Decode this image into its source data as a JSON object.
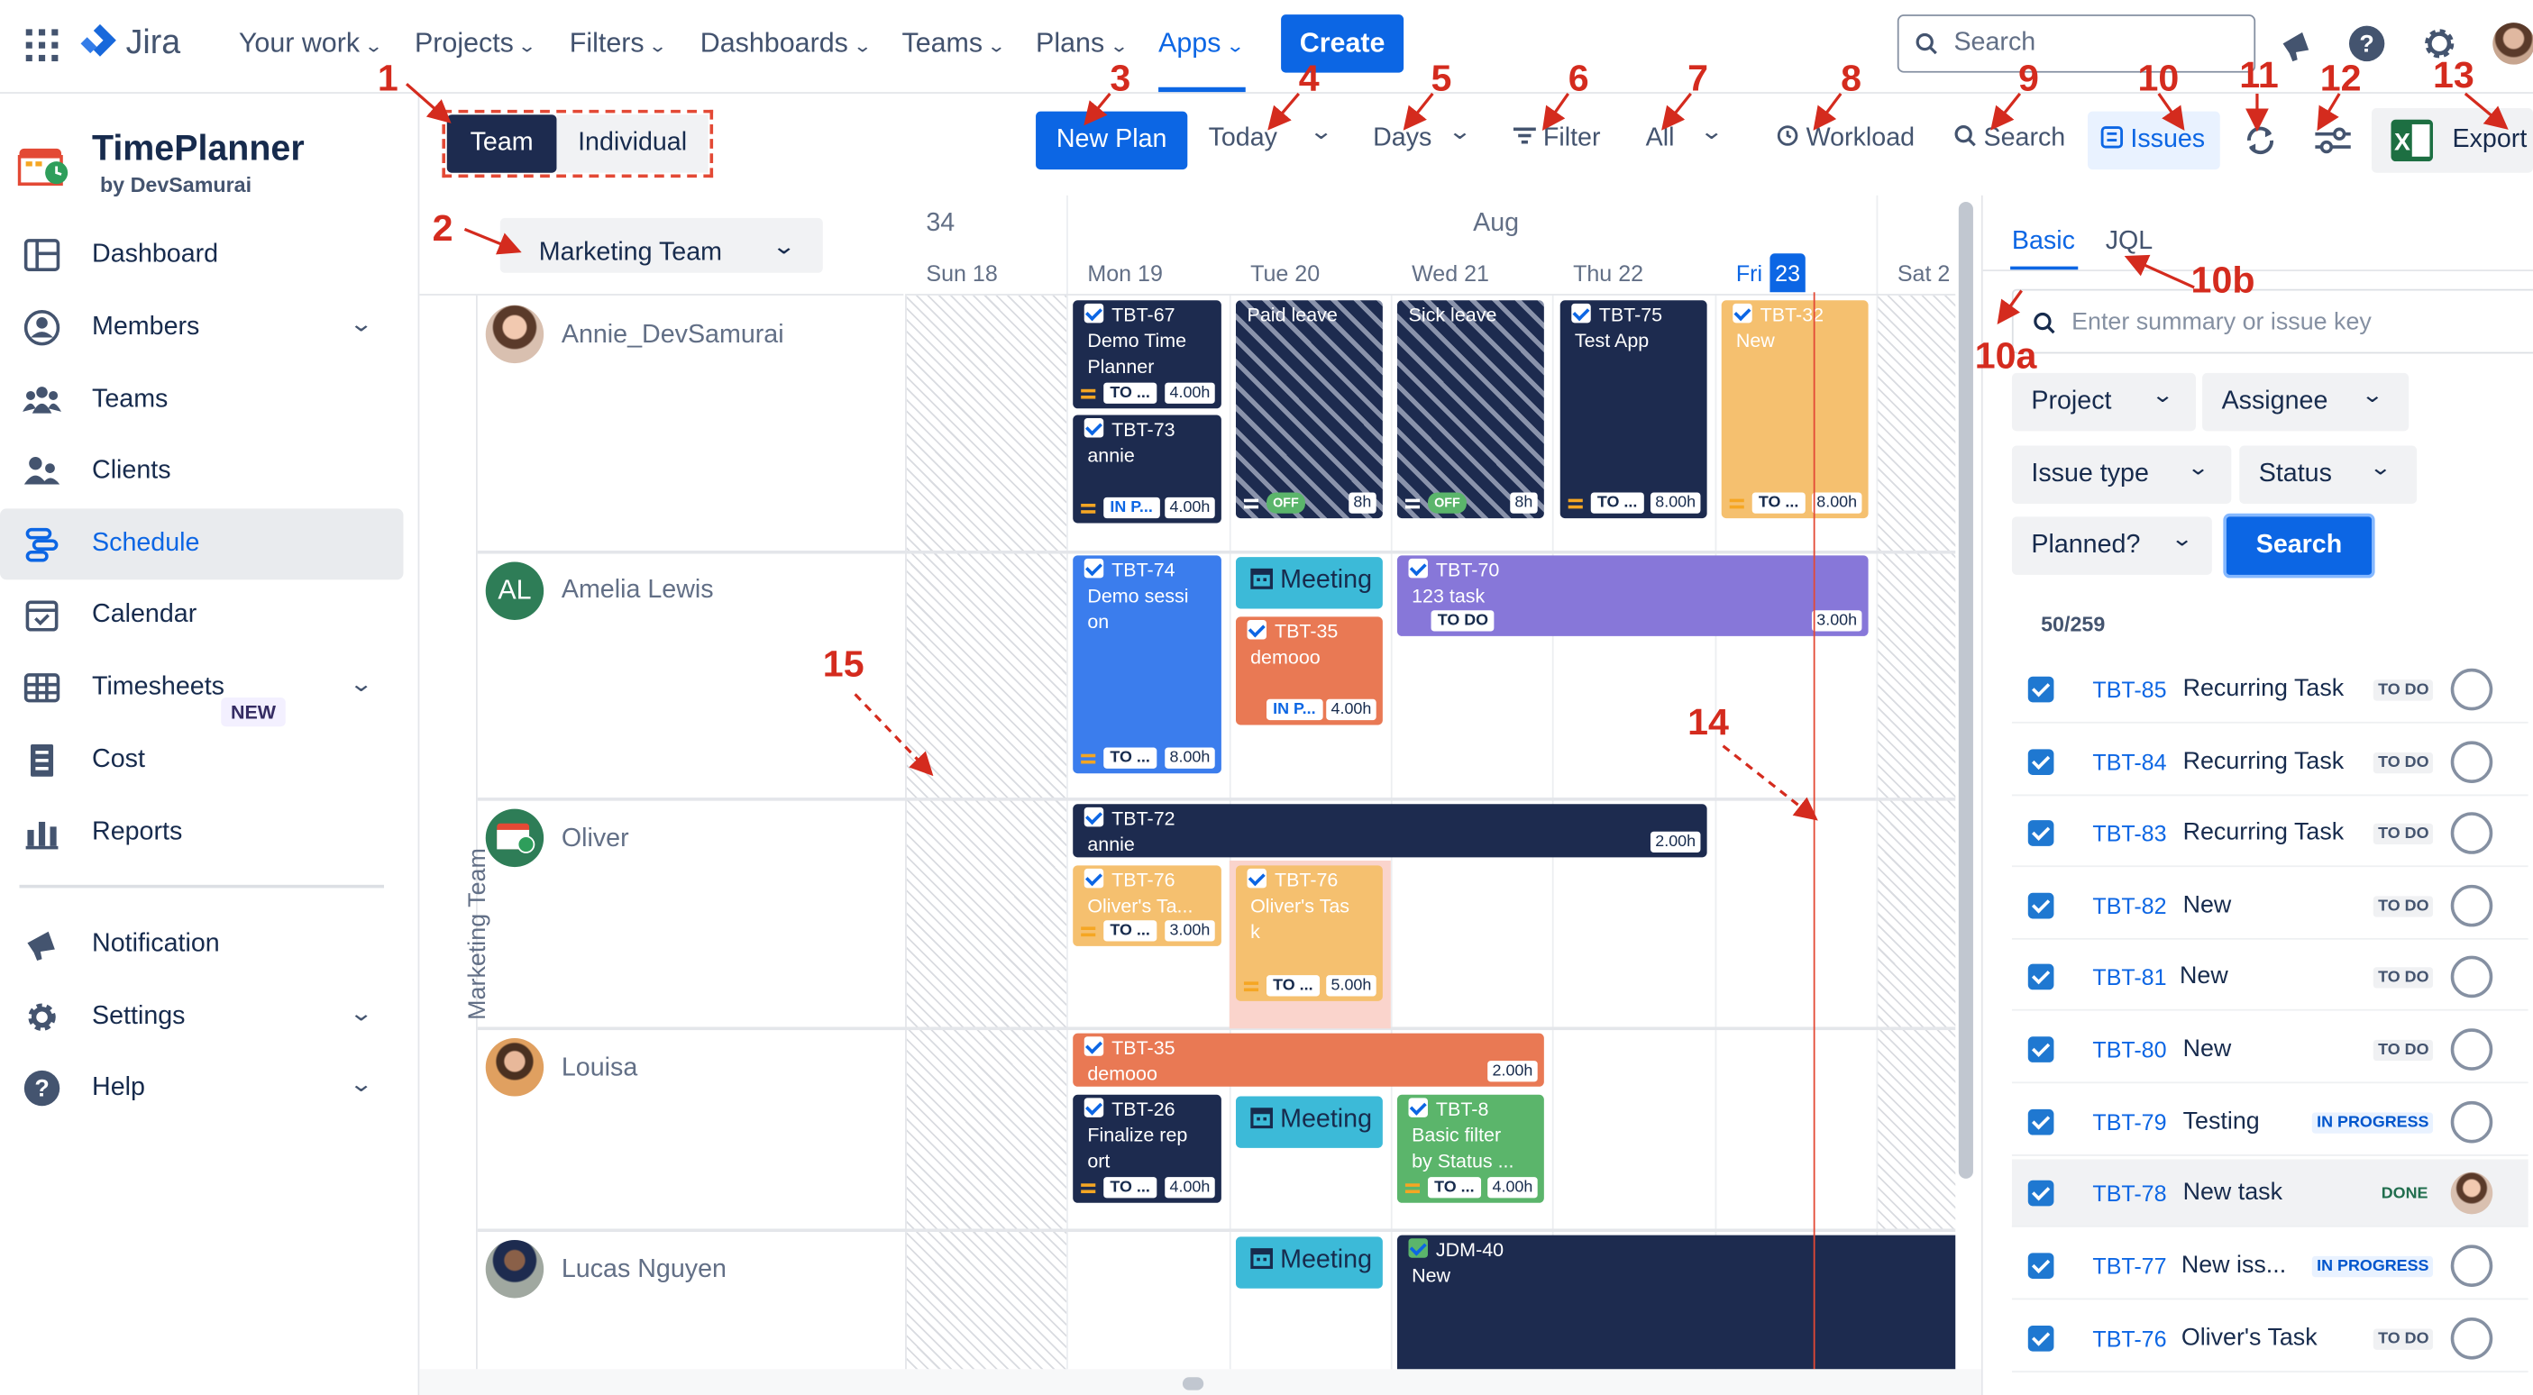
{
  "topnav": {
    "product": "Jira",
    "items": [
      {
        "label": "Your work"
      },
      {
        "label": "Projects"
      },
      {
        "label": "Filters"
      },
      {
        "label": "Dashboards"
      },
      {
        "label": "Teams"
      },
      {
        "label": "Plans"
      },
      {
        "label": "Apps"
      }
    ],
    "create_label": "Create",
    "search_placeholder": "Search"
  },
  "sidebar": {
    "app_title": "TimePlanner",
    "app_subtitle": "by DevSamurai",
    "items": [
      {
        "label": "Dashboard",
        "icon": "dashboard-icon"
      },
      {
        "label": "Members",
        "icon": "members-icon"
      },
      {
        "label": "Teams",
        "icon": "teams-icon"
      },
      {
        "label": "Clients",
        "icon": "clients-icon"
      },
      {
        "label": "Schedule",
        "icon": "schedule-icon"
      },
      {
        "label": "Calendar",
        "icon": "calendar-icon"
      },
      {
        "label": "Timesheets",
        "icon": "timesheets-icon"
      },
      {
        "label": "Cost",
        "icon": "cost-icon"
      },
      {
        "label": "Reports",
        "icon": "reports-icon"
      },
      {
        "label": "Notification",
        "icon": "megaphone-icon"
      },
      {
        "label": "Settings",
        "icon": "gear-icon"
      },
      {
        "label": "Help",
        "icon": "help-icon"
      }
    ],
    "new_badge": "NEW"
  },
  "toolbar": {
    "team_tab": "Team",
    "individual_tab": "Individual",
    "new_plan": "New Plan",
    "today": "Today",
    "days": "Days",
    "filter": "Filter",
    "all": "All",
    "workload": "Workload",
    "search": "Search",
    "issues": "Issues",
    "export": "Export"
  },
  "team_select": "Marketing Team",
  "team_vertical_label": "Marketing Team",
  "calendar": {
    "week": "34",
    "month": "Aug",
    "days": [
      {
        "label": "Sun 18"
      },
      {
        "label": "Mon 19"
      },
      {
        "label": "Tue 20"
      },
      {
        "label": "Wed 21"
      },
      {
        "label": "Thu 22"
      },
      {
        "label": "Fri",
        "num": "23"
      },
      {
        "label": "Sat 2"
      }
    ]
  },
  "people": [
    {
      "name": "Annie_DevSamurai"
    },
    {
      "name": "Amelia Lewis",
      "initials": "AL"
    },
    {
      "name": "Oliver"
    },
    {
      "name": "Louisa"
    },
    {
      "name": "Lucas Nguyen"
    }
  ],
  "cards": {
    "c1": {
      "key": "TBT-67",
      "title": "Demo Time\nPlanner",
      "status": "TO ...",
      "hours": "4.00h"
    },
    "c2": {
      "key": "TBT-73",
      "title": "annie",
      "status": "IN P...",
      "hours": "4.00h"
    },
    "c3": {
      "title": "Paid leave",
      "status": "OFF",
      "hours": "8h"
    },
    "c4": {
      "title": "Sick leave",
      "status": "OFF",
      "hours": "8h"
    },
    "c5": {
      "key": "TBT-75",
      "title": "Test App",
      "status": "TO ...",
      "hours": "8.00h"
    },
    "c6": {
      "key": "TBT-32",
      "title": "New",
      "status": "TO ...",
      "hours": "8.00h"
    },
    "c7": {
      "key": "TBT-74",
      "title": "Demo sessi\non",
      "status": "TO ...",
      "hours": "8.00h"
    },
    "c8": {
      "title": "Meeting"
    },
    "c9": {
      "key": "TBT-35",
      "title": "demooo",
      "status": "IN P...",
      "hours": "4.00h"
    },
    "c10": {
      "key": "TBT-70",
      "title": "123 task",
      "status": "TO DO",
      "hours": "3.00h"
    },
    "c11": {
      "key": "TBT-72",
      "title": "annie",
      "hours": "2.00h"
    },
    "c12": {
      "key": "TBT-76",
      "title": "Oliver's Ta...",
      "status": "TO ...",
      "hours": "3.00h"
    },
    "c13": {
      "key": "TBT-76",
      "title": "Oliver's Tas\nk",
      "status": "TO ...",
      "hours": "5.00h"
    },
    "c14": {
      "key": "TBT-35",
      "title": "demooo",
      "hours": "2.00h"
    },
    "c15": {
      "key": "TBT-26",
      "title": "Finalize rep\nort",
      "status": "TO ...",
      "hours": "4.00h"
    },
    "c16": {
      "title": "Meeting"
    },
    "c17": {
      "key": "TBT-8",
      "title": "Basic filter\nby Status ...",
      "status": "TO ...",
      "hours": "4.00h"
    },
    "c18": {
      "title": "Meeting"
    },
    "c19": {
      "key": "JDM-40",
      "title": "New"
    }
  },
  "right_panel": {
    "tab_basic": "Basic",
    "tab_jql": "JQL",
    "search_placeholder": "Enter summary or issue key",
    "filters": {
      "project": "Project",
      "assignee": "Assignee",
      "issue_type": "Issue type",
      "status": "Status",
      "planned": "Planned?"
    },
    "search_button": "Search",
    "count": "50/259",
    "issues": [
      {
        "key": "TBT-85",
        "title": "Recurring Task",
        "status": "TO DO"
      },
      {
        "key": "TBT-84",
        "title": "Recurring Task",
        "status": "TO DO"
      },
      {
        "key": "TBT-83",
        "title": "Recurring Task",
        "status": "TO DO"
      },
      {
        "key": "TBT-82",
        "title": "New",
        "status": "TO DO"
      },
      {
        "key": "TBT-81",
        "title": "New",
        "status": "TO DO"
      },
      {
        "key": "TBT-80",
        "title": "New",
        "status": "TO DO"
      },
      {
        "key": "TBT-79",
        "title": "Testing",
        "status": "IN PROGRESS"
      },
      {
        "key": "TBT-78",
        "title": "New task",
        "status": "DONE"
      },
      {
        "key": "TBT-77",
        "title": "New iss...",
        "status": "IN PROGRESS"
      },
      {
        "key": "TBT-76",
        "title": "Oliver's Task",
        "status": "TO DO"
      }
    ]
  },
  "annotations": [
    "1",
    "2",
    "3",
    "4",
    "5",
    "6",
    "7",
    "8",
    "9",
    "10",
    "11",
    "12",
    "13",
    "14",
    "15",
    "10a",
    "10b"
  ],
  "colors": {
    "accent": "#0c66e4",
    "navy": "#1d2b4f",
    "annotation": "#d42b1e"
  }
}
